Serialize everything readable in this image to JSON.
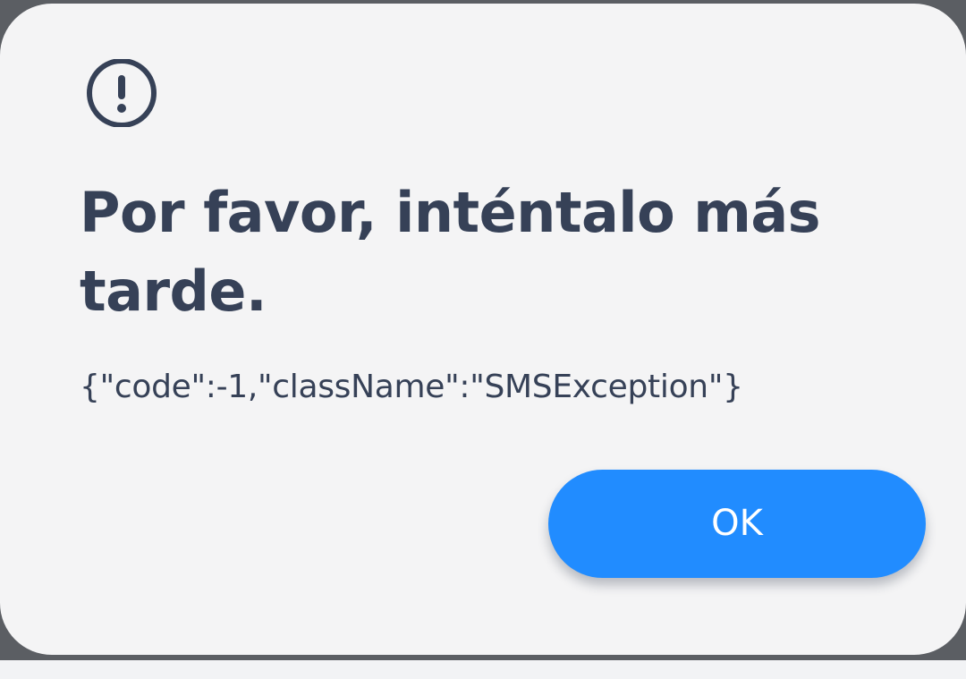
{
  "dialog": {
    "icon": "exclamation-circle-icon",
    "title": "Por favor, inténtalo más tarde.",
    "message": "{\"code\":-1,\"className\":\"SMSException\"}",
    "ok_label": "OK"
  },
  "colors": {
    "text": "#364157",
    "dialog_background": "#f4f4f5",
    "button_background": "#218cff",
    "button_text": "#ffffff"
  }
}
